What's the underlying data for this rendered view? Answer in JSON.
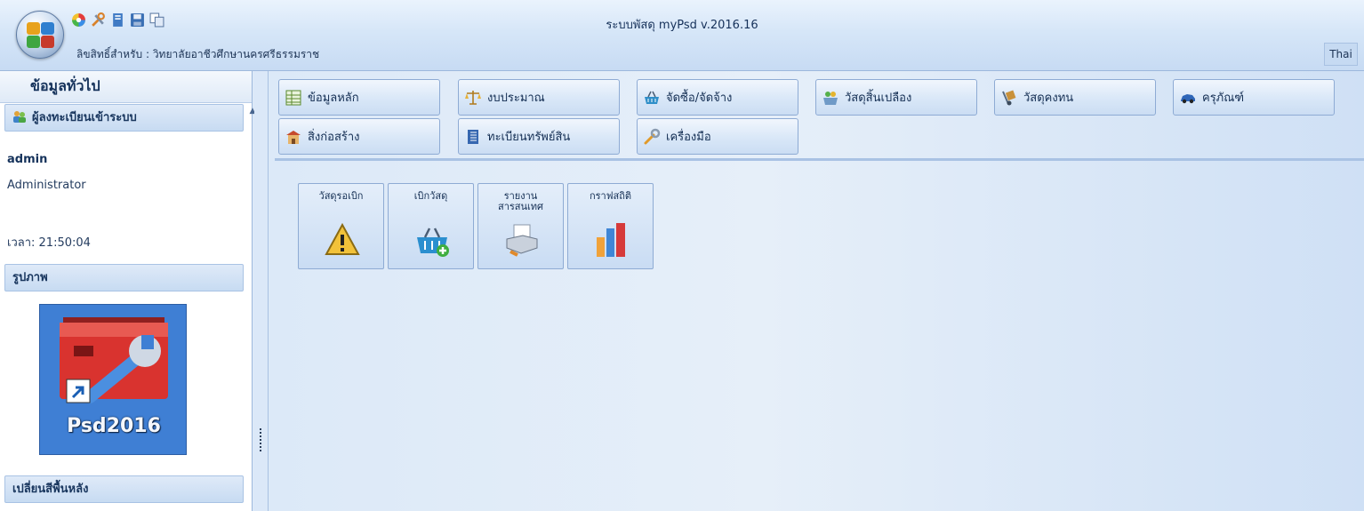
{
  "window": {
    "title": "ระบบพัสดุ myPsd v.2016.16",
    "license_text": "ลิขสิทธิ์สำหรับ : วิทยาลัยอาชีวศึกษานครศรีธรรมราช",
    "language": "Thai"
  },
  "quick_access": {
    "icons": [
      "color-wheel-icon",
      "tools-icon",
      "book-icon",
      "save-icon",
      "copy-icon"
    ]
  },
  "sidebar": {
    "title": "ข้อมูลทั่วไป",
    "sections": {
      "login": "ผู้ลงทะเบียนเข้าระบบ",
      "image": "รูปภาพ",
      "background": "เปลี่ยนสีพื้นหลัง"
    },
    "user": {
      "name": "admin",
      "role": "Administrator",
      "time": "เวลา: 21:50:04"
    },
    "shortcut_label": "Psd2016"
  },
  "menu_buttons": [
    {
      "label": "ข้อมูลหลัก",
      "icon": "table-icon"
    },
    {
      "label": "งบประมาณ",
      "icon": "scales-icon"
    },
    {
      "label": "จัดซื้อ/จัดจ้าง",
      "icon": "basket-icon"
    },
    {
      "label": "วัสดุสิ้นเปลือง",
      "icon": "supplies-basket-icon"
    },
    {
      "label": "วัสดุคงทน",
      "icon": "hand-truck-icon"
    },
    {
      "label": "ครุภัณฑ์",
      "icon": "car-icon"
    },
    {
      "label": "สิ่งก่อสร้าง",
      "icon": "building-icon"
    },
    {
      "label": "ทะเบียนทรัพย์สิน",
      "icon": "ledger-icon"
    },
    {
      "label": "เครื่องมือ",
      "icon": "wrench-icon"
    }
  ],
  "tiles": [
    {
      "label": "วัสดุรอเบิก",
      "icon": "warning-icon"
    },
    {
      "label": "เบิกวัสดุ",
      "icon": "basket-add-icon"
    },
    {
      "label": "รายงาน\nสารสนเทศ",
      "icon": "printer-icon"
    },
    {
      "label": "กราฟสถิติ",
      "icon": "bar-chart-icon"
    }
  ]
}
